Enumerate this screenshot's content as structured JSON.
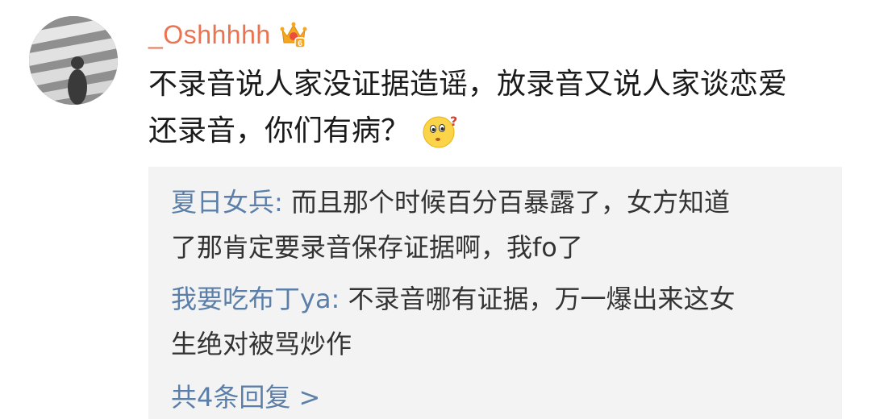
{
  "comment": {
    "username": "_Oshhhhh",
    "badge_icon": "vip-crown-icon",
    "text_line_1": "不录音说人家没证据造谣，放录音又说人家谈恋爱",
    "text_line_2": "还录音，你们有病？",
    "emoji_icon": "thinking-face-icon"
  },
  "replies": [
    {
      "author": "夏日女兵:",
      "text_line_1": "而且那个时候百分百暴露了，女方知道",
      "text_line_2": "了那肯定要录音保存证据啊，我fo了"
    },
    {
      "author": "我要吃布丁ya:",
      "text_line_1": "不录音哪有证据，万一爆出来这女",
      "text_line_2": "生绝对被骂炒作"
    }
  ],
  "more_replies_label": "共4条回复 >",
  "colors": {
    "username": "#eb7350",
    "reply_author": "#5b7fa8",
    "reply_background": "#f3f3f3"
  }
}
